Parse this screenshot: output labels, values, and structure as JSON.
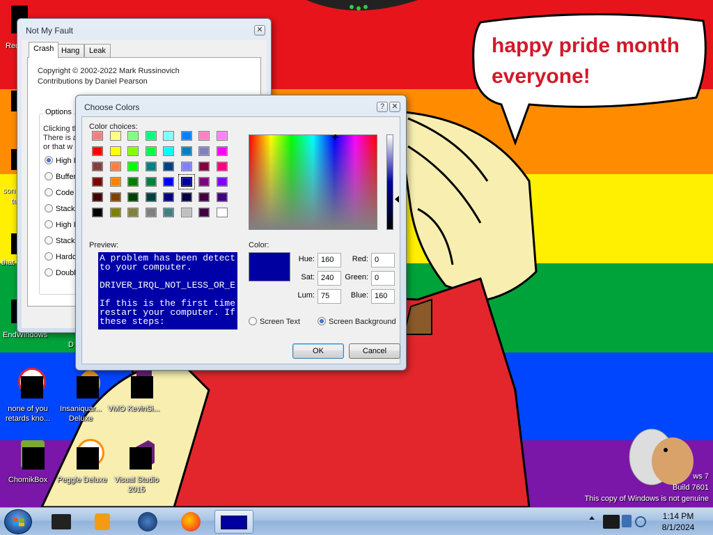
{
  "desktop": {
    "bubble_text": "happy pride month everyone!",
    "icons": [
      {
        "label": "none of you retards kno..."
      },
      {
        "label": "Insaniquar... Deluxe"
      },
      {
        "label": "VMO KevinSi..."
      },
      {
        "label": "ChomikBox"
      },
      {
        "label": "Peggle Deluxe"
      },
      {
        "label": "Visual Studio 2015"
      }
    ],
    "edge_labels": [
      "Rec",
      "son",
      "te",
      "that",
      "EndWindows"
    ],
    "edge_label_behind": "D",
    "watermark": {
      "line1": "ws 7",
      "line2": "Build 7601",
      "line3": "This copy of Windows is not genuine"
    }
  },
  "nmf_window": {
    "title": "Not My Fault",
    "close": "✕",
    "tabs": [
      "Crash",
      "Hang",
      "Leak"
    ],
    "copyright": "Copyright © 2002-2022 Mark Russinovich",
    "contributions": "Contributions by Daniel Pearson",
    "options_legend": "Options",
    "desc_lines": [
      "Clicking th",
      "There is a",
      "or that w"
    ],
    "options": [
      "High IR",
      "Buffer",
      "Code o",
      "Stack",
      "High IR",
      "Stack",
      "Hardco",
      "Double"
    ]
  },
  "colors_dialog": {
    "title": "Choose Colors",
    "help": "?",
    "close": "✕",
    "color_choices_label": "Color choices:",
    "swatches": [
      [
        "#f08080",
        "#ffff80",
        "#80ff80",
        "#00ff80",
        "#80ffff",
        "#0080ff",
        "#ff80c0",
        "#ff80ff"
      ],
      [
        "#ff0000",
        "#ffff00",
        "#80ff00",
        "#00ff40",
        "#00ffff",
        "#0080c0",
        "#8080c0",
        "#ff00ff"
      ],
      [
        "#804040",
        "#ff8040",
        "#00ff00",
        "#008080",
        "#004080",
        "#8080ff",
        "#800040",
        "#ff0080"
      ],
      [
        "#800000",
        "#ff8000",
        "#008000",
        "#008040",
        "#0000ff",
        "#0000a0",
        "#800080",
        "#8000ff"
      ],
      [
        "#400000",
        "#804000",
        "#004000",
        "#004040",
        "#000080",
        "#000040",
        "#400040",
        "#400080"
      ],
      [
        "#000000",
        "#808000",
        "#808040",
        "#808080",
        "#408080",
        "#c0c0c0",
        "#400040",
        "#ffffff"
      ]
    ],
    "selected_swatch": "row 4 col 6",
    "preview_label": "Preview:",
    "preview_lines": [
      "A problem has been detect",
      "to your computer.",
      "",
      "DRIVER_IRQL_NOT_LESS_OR_E",
      "",
      "If this is the first time",
      "restart your computer. If",
      "these steps:"
    ],
    "color_label": "Color:",
    "hue_label": "Hue:",
    "hue": "160",
    "sat_label": "Sat:",
    "sat": "240",
    "lum_label": "Lum:",
    "lum": "75",
    "red_label": "Red:",
    "red": "0",
    "green_label": "Green:",
    "green": "0",
    "blue_label": "Blue:",
    "blue": "160",
    "selected_color": "#0000a0",
    "screen_text_label": "Screen Text",
    "screen_background_label": "Screen Background",
    "ok": "OK",
    "cancel": "Cancel"
  },
  "taskbar": {
    "time": "1:14 PM",
    "date": "8/1/2024"
  }
}
